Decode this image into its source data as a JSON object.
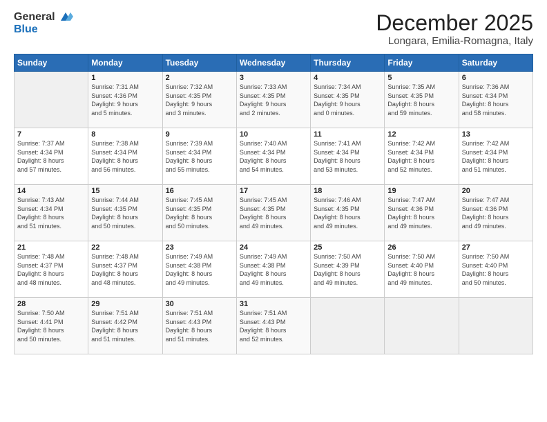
{
  "header": {
    "logo_general": "General",
    "logo_blue": "Blue",
    "month": "December 2025",
    "location": "Longara, Emilia-Romagna, Italy"
  },
  "weekdays": [
    "Sunday",
    "Monday",
    "Tuesday",
    "Wednesday",
    "Thursday",
    "Friday",
    "Saturday"
  ],
  "weeks": [
    [
      {
        "day": "",
        "info": ""
      },
      {
        "day": "1",
        "info": "Sunrise: 7:31 AM\nSunset: 4:36 PM\nDaylight: 9 hours\nand 5 minutes."
      },
      {
        "day": "2",
        "info": "Sunrise: 7:32 AM\nSunset: 4:35 PM\nDaylight: 9 hours\nand 3 minutes."
      },
      {
        "day": "3",
        "info": "Sunrise: 7:33 AM\nSunset: 4:35 PM\nDaylight: 9 hours\nand 2 minutes."
      },
      {
        "day": "4",
        "info": "Sunrise: 7:34 AM\nSunset: 4:35 PM\nDaylight: 9 hours\nand 0 minutes."
      },
      {
        "day": "5",
        "info": "Sunrise: 7:35 AM\nSunset: 4:35 PM\nDaylight: 8 hours\nand 59 minutes."
      },
      {
        "day": "6",
        "info": "Sunrise: 7:36 AM\nSunset: 4:34 PM\nDaylight: 8 hours\nand 58 minutes."
      }
    ],
    [
      {
        "day": "7",
        "info": "Sunrise: 7:37 AM\nSunset: 4:34 PM\nDaylight: 8 hours\nand 57 minutes."
      },
      {
        "day": "8",
        "info": "Sunrise: 7:38 AM\nSunset: 4:34 PM\nDaylight: 8 hours\nand 56 minutes."
      },
      {
        "day": "9",
        "info": "Sunrise: 7:39 AM\nSunset: 4:34 PM\nDaylight: 8 hours\nand 55 minutes."
      },
      {
        "day": "10",
        "info": "Sunrise: 7:40 AM\nSunset: 4:34 PM\nDaylight: 8 hours\nand 54 minutes."
      },
      {
        "day": "11",
        "info": "Sunrise: 7:41 AM\nSunset: 4:34 PM\nDaylight: 8 hours\nand 53 minutes."
      },
      {
        "day": "12",
        "info": "Sunrise: 7:42 AM\nSunset: 4:34 PM\nDaylight: 8 hours\nand 52 minutes."
      },
      {
        "day": "13",
        "info": "Sunrise: 7:42 AM\nSunset: 4:34 PM\nDaylight: 8 hours\nand 51 minutes."
      }
    ],
    [
      {
        "day": "14",
        "info": "Sunrise: 7:43 AM\nSunset: 4:34 PM\nDaylight: 8 hours\nand 51 minutes."
      },
      {
        "day": "15",
        "info": "Sunrise: 7:44 AM\nSunset: 4:35 PM\nDaylight: 8 hours\nand 50 minutes."
      },
      {
        "day": "16",
        "info": "Sunrise: 7:45 AM\nSunset: 4:35 PM\nDaylight: 8 hours\nand 50 minutes."
      },
      {
        "day": "17",
        "info": "Sunrise: 7:45 AM\nSunset: 4:35 PM\nDaylight: 8 hours\nand 49 minutes."
      },
      {
        "day": "18",
        "info": "Sunrise: 7:46 AM\nSunset: 4:35 PM\nDaylight: 8 hours\nand 49 minutes."
      },
      {
        "day": "19",
        "info": "Sunrise: 7:47 AM\nSunset: 4:36 PM\nDaylight: 8 hours\nand 49 minutes."
      },
      {
        "day": "20",
        "info": "Sunrise: 7:47 AM\nSunset: 4:36 PM\nDaylight: 8 hours\nand 49 minutes."
      }
    ],
    [
      {
        "day": "21",
        "info": "Sunrise: 7:48 AM\nSunset: 4:37 PM\nDaylight: 8 hours\nand 48 minutes."
      },
      {
        "day": "22",
        "info": "Sunrise: 7:48 AM\nSunset: 4:37 PM\nDaylight: 8 hours\nand 48 minutes."
      },
      {
        "day": "23",
        "info": "Sunrise: 7:49 AM\nSunset: 4:38 PM\nDaylight: 8 hours\nand 49 minutes."
      },
      {
        "day": "24",
        "info": "Sunrise: 7:49 AM\nSunset: 4:38 PM\nDaylight: 8 hours\nand 49 minutes."
      },
      {
        "day": "25",
        "info": "Sunrise: 7:50 AM\nSunset: 4:39 PM\nDaylight: 8 hours\nand 49 minutes."
      },
      {
        "day": "26",
        "info": "Sunrise: 7:50 AM\nSunset: 4:40 PM\nDaylight: 8 hours\nand 49 minutes."
      },
      {
        "day": "27",
        "info": "Sunrise: 7:50 AM\nSunset: 4:40 PM\nDaylight: 8 hours\nand 50 minutes."
      }
    ],
    [
      {
        "day": "28",
        "info": "Sunrise: 7:50 AM\nSunset: 4:41 PM\nDaylight: 8 hours\nand 50 minutes."
      },
      {
        "day": "29",
        "info": "Sunrise: 7:51 AM\nSunset: 4:42 PM\nDaylight: 8 hours\nand 51 minutes."
      },
      {
        "day": "30",
        "info": "Sunrise: 7:51 AM\nSunset: 4:43 PM\nDaylight: 8 hours\nand 51 minutes."
      },
      {
        "day": "31",
        "info": "Sunrise: 7:51 AM\nSunset: 4:43 PM\nDaylight: 8 hours\nand 52 minutes."
      },
      {
        "day": "",
        "info": ""
      },
      {
        "day": "",
        "info": ""
      },
      {
        "day": "",
        "info": ""
      }
    ]
  ]
}
